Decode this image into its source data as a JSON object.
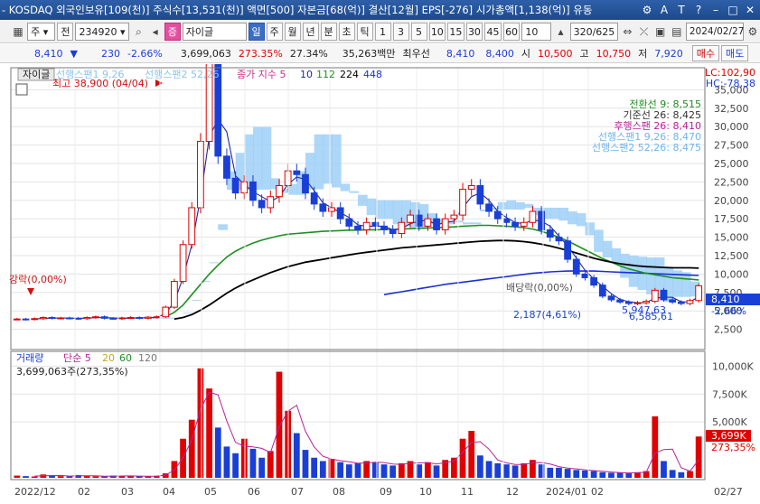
{
  "window": {
    "title": "- KOSDAQ 외국인보유[109(천)] 주식수[13,531(천)] 액면[500] 자본금[68(억)] 결산[12월] EPS[-276] 시가총액[1,138(억)] 유동"
  },
  "toolbar": {
    "period_select": "주",
    "prev_label": "전",
    "code": "234920",
    "stock_name": "자이글",
    "badge": "증",
    "periods": [
      "일",
      "주",
      "월",
      "년",
      "분",
      "초",
      "틱"
    ],
    "active_period": "일",
    "minutes": [
      "1",
      "3",
      "5",
      "10",
      "15",
      "30",
      "45",
      "60"
    ],
    "count_value": "10",
    "range": "320/625",
    "date": "2024/02/27"
  },
  "quote": {
    "price": "8,410",
    "change": "230",
    "change_pct": "-2.66%",
    "volume": "3,699,063",
    "volume_pct": "273.35%",
    "turnover_pct": "27.34%",
    "amount": "35,263백만",
    "best_label": "최우선",
    "ask": "8,410",
    "bid": "8,400",
    "open_label": "시",
    "open": "10,500",
    "high_label": "고",
    "high": "10,750",
    "low_label": "저",
    "low": "7,920",
    "buy_label": "매수",
    "sell_label": "매도"
  },
  "colors": {
    "up": "#e00000",
    "down": "#1a3fd6",
    "cloud": "#9fd0f7",
    "ma5": "#1f2a9a",
    "ma112": "#1f8f1f",
    "ma224": "#000000",
    "ma448": "#1c2fd6"
  },
  "chart_data": [
    {
      "type": "line",
      "title": "자이글",
      "legend": [
        {
          "label": "선행스팬1 9,26",
          "color": "#9fd0f7"
        },
        {
          "label": "선행스팬2 52,26",
          "color": "#9fd0f7"
        },
        {
          "label": "종가 지수 5",
          "color": "#cc2b8c"
        },
        {
          "label": "10",
          "color": "#1f2a9a"
        },
        {
          "label": "112",
          "color": "#1f8f1f"
        },
        {
          "label": "224",
          "color": "#000000"
        },
        {
          "label": "448",
          "color": "#1c2fd6"
        }
      ],
      "ylim": [
        0,
        37500
      ],
      "yticks": [
        2500,
        5000,
        7500,
        10000,
        12500,
        15000,
        17500,
        20000,
        22500,
        25000,
        27500,
        30000,
        32500,
        35000
      ],
      "xticks": [
        "2022/12",
        "02",
        "03",
        "04",
        "05",
        "06",
        "07",
        "08",
        "09",
        "10",
        "11",
        "12",
        "2024/01",
        "02",
        "02/27"
      ],
      "header_right": [
        "LC:102,90",
        "HC:-78,38"
      ],
      "price_tag": "8,410",
      "price_tag_pct": "-2.66%",
      "annotations": {
        "max": "최고 38,900 (04/04)",
        "left_label": "강락(0,00%)",
        "mid_label": "배당락(0,00%)",
        "low_label": "2,187(4,61%)",
        "val1": "5,947,63",
        "val2": "6,585,61"
      },
      "ichimoku": [
        {
          "label": "전환선 9: 8,515",
          "color": "#1f8f1f"
        },
        {
          "label": "기준선 26: 8,425",
          "color": "#333333"
        },
        {
          "label": "후행스팬 26: 8,410",
          "color": "#b7229a"
        },
        {
          "label": "선행스팬1 9,26: 8,470",
          "color": "#6fb5ee"
        },
        {
          "label": "선행스팬2 52,26: 8,475",
          "color": "#6fb5ee"
        }
      ],
      "close_series": [
        3900,
        3850,
        3950,
        4100,
        4000,
        4050,
        4000,
        3950,
        4100,
        4200,
        4000,
        3950,
        4050,
        4100,
        4000,
        4150,
        4200,
        5500,
        9000,
        14000,
        19000,
        28000,
        38900,
        26000,
        23000,
        21000,
        22500,
        20000,
        19000,
        20500,
        22000,
        24000,
        23500,
        21000,
        19500,
        18500,
        19000,
        17500,
        16500,
        16000,
        17000,
        16500,
        16000,
        15500,
        17000,
        18000,
        16500,
        17500,
        16000,
        17500,
        18000,
        21500,
        22000,
        19500,
        18500,
        17500,
        17000,
        16500,
        17000,
        18500,
        16000,
        15000,
        14500,
        12000,
        10000,
        9500,
        8500,
        7000,
        6500,
        6200,
        6000,
        6100,
        6300,
        7800,
        6500,
        6200,
        6000,
        6400,
        8410
      ],
      "ma112": [
        null,
        null,
        null,
        null,
        null,
        null,
        null,
        null,
        null,
        null,
        null,
        null,
        null,
        null,
        null,
        null,
        null,
        4200,
        4800,
        5800,
        7200,
        8600,
        10000,
        11200,
        12300,
        13100,
        13700,
        14200,
        14600,
        14900,
        15200,
        15400,
        15500,
        15600,
        15700,
        15800,
        15850,
        15900,
        15950,
        15950,
        16000,
        16000,
        16050,
        16050,
        16100,
        16150,
        16200,
        16250,
        16300,
        16350,
        16400,
        16500,
        16550,
        16600,
        16600,
        16550,
        16500,
        16400,
        16300,
        16100,
        15800,
        15400,
        15000,
        14500,
        13900,
        13300,
        12700,
        12100,
        11600,
        11100,
        10700,
        10400,
        10100,
        9900,
        9700,
        9500,
        9400,
        9300,
        9200
      ],
      "ma224": [
        null,
        null,
        null,
        null,
        null,
        null,
        null,
        null,
        null,
        null,
        null,
        null,
        null,
        null,
        null,
        null,
        null,
        null,
        3900,
        4100,
        4500,
        5100,
        5800,
        6600,
        7400,
        8100,
        8700,
        9200,
        9700,
        10200,
        10600,
        11000,
        11300,
        11600,
        11800,
        12000,
        12200,
        12400,
        12600,
        12800,
        12950,
        13100,
        13250,
        13400,
        13550,
        13650,
        13750,
        13850,
        13950,
        14050,
        14150,
        14250,
        14350,
        14450,
        14500,
        14550,
        14550,
        14500,
        14400,
        14250,
        14050,
        13800,
        13500,
        13200,
        12850,
        12500,
        12150,
        11850,
        11600,
        11400,
        11250,
        11100,
        11000,
        10950,
        10900,
        10850,
        10850,
        10850,
        10800
      ],
      "ma448": [
        null,
        null,
        null,
        null,
        null,
        null,
        null,
        null,
        null,
        null,
        null,
        null,
        null,
        null,
        null,
        null,
        null,
        null,
        null,
        null,
        null,
        null,
        null,
        null,
        null,
        null,
        null,
        null,
        null,
        null,
        null,
        null,
        null,
        null,
        null,
        null,
        null,
        null,
        null,
        null,
        null,
        null,
        7200,
        7400,
        7600,
        7800,
        8000,
        8200,
        8400,
        8600,
        8750,
        8900,
        9050,
        9200,
        9350,
        9500,
        9650,
        9800,
        9950,
        10100,
        10200,
        10300,
        10350,
        10400,
        10400,
        10400,
        10400,
        10350,
        10300,
        10250,
        10200,
        10150,
        10100,
        10050,
        10000,
        9950,
        9900,
        9850,
        9800
      ]
    },
    {
      "type": "bar",
      "title": "거래량",
      "legend": [
        {
          "label": "단순 5",
          "color": "#b7229a"
        },
        {
          "label": "20",
          "color": "#c8a800"
        },
        {
          "label": "60",
          "color": "#1f8f1f"
        },
        {
          "label": "120",
          "color": "#777777"
        }
      ],
      "ylim": [
        0,
        11000000
      ],
      "yticks": [
        5000000,
        7500000,
        10000000
      ],
      "ytick_labels": [
        "5,000K",
        "7,500K",
        "10,000K"
      ],
      "volume_text": "3,699,063주(273,35%)",
      "volume_tag": "3,699K",
      "volume_tag_pct": "273,35%",
      "values": [
        200000,
        150000,
        120000,
        300000,
        180000,
        150000,
        130000,
        250000,
        160000,
        140000,
        120000,
        200000,
        170000,
        150000,
        130000,
        160000,
        180000,
        400000,
        1500000,
        3500000,
        5200000,
        9800000,
        8000000,
        4500000,
        2800000,
        2200000,
        3500000,
        2600000,
        1800000,
        2400000,
        9500000,
        6000000,
        4000000,
        2500000,
        1800000,
        1500000,
        1700000,
        1400000,
        1200000,
        1300000,
        1500000,
        1400000,
        1200000,
        1100000,
        1300000,
        1500000,
        1200000,
        1400000,
        1100000,
        1600000,
        1800000,
        3500000,
        4200000,
        2000000,
        1500000,
        1300000,
        1200000,
        1100000,
        1300000,
        1600000,
        1200000,
        900000,
        900000,
        800000,
        700000,
        650000,
        600000,
        500000,
        450000,
        450000,
        400000,
        500000,
        600000,
        5500000,
        1500000,
        700000,
        500000,
        600000,
        3699063
      ],
      "up": [
        1,
        0,
        1,
        1,
        0,
        1,
        0,
        0,
        1,
        1,
        0,
        0,
        1,
        1,
        0,
        1,
        1,
        1,
        1,
        1,
        1,
        1,
        1,
        0,
        0,
        0,
        1,
        0,
        0,
        1,
        1,
        1,
        0,
        0,
        0,
        0,
        1,
        0,
        0,
        0,
        1,
        0,
        0,
        0,
        1,
        1,
        0,
        1,
        0,
        1,
        1,
        1,
        1,
        0,
        0,
        0,
        0,
        0,
        1,
        1,
        0,
        0,
        0,
        0,
        0,
        0,
        0,
        0,
        0,
        0,
        0,
        1,
        1,
        1,
        0,
        0,
        0,
        1,
        1
      ]
    }
  ]
}
